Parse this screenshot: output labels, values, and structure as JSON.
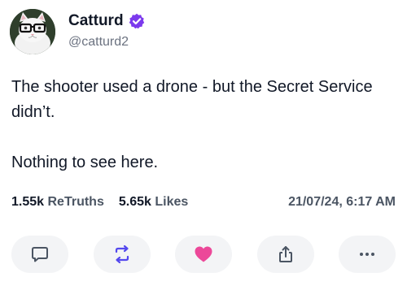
{
  "author": {
    "display_name": "Catturd",
    "handle": "@catturd2",
    "verified": true,
    "verified_color": "#7c3aed",
    "avatar_icon": "cat-with-glasses-avatar"
  },
  "post": {
    "paragraphs": [
      "The shooter used a drone - but the Secret Service didn’t.",
      "Nothing to see here."
    ]
  },
  "stats": {
    "retruths_count": "1.55k",
    "retruths_label": "ReTruths",
    "likes_count": "5.65k",
    "likes_label": "Likes",
    "timestamp": "21/07/24, 6:17 AM"
  },
  "actions": [
    {
      "name": "reply",
      "icon": "speech-bubble-icon"
    },
    {
      "name": "retruth",
      "icon": "repost-arrows-icon",
      "color": "#5448ee"
    },
    {
      "name": "like",
      "icon": "heart-icon",
      "color": "#ec4899"
    },
    {
      "name": "share",
      "icon": "share-icon"
    },
    {
      "name": "more",
      "icon": "more-dots-icon"
    }
  ]
}
